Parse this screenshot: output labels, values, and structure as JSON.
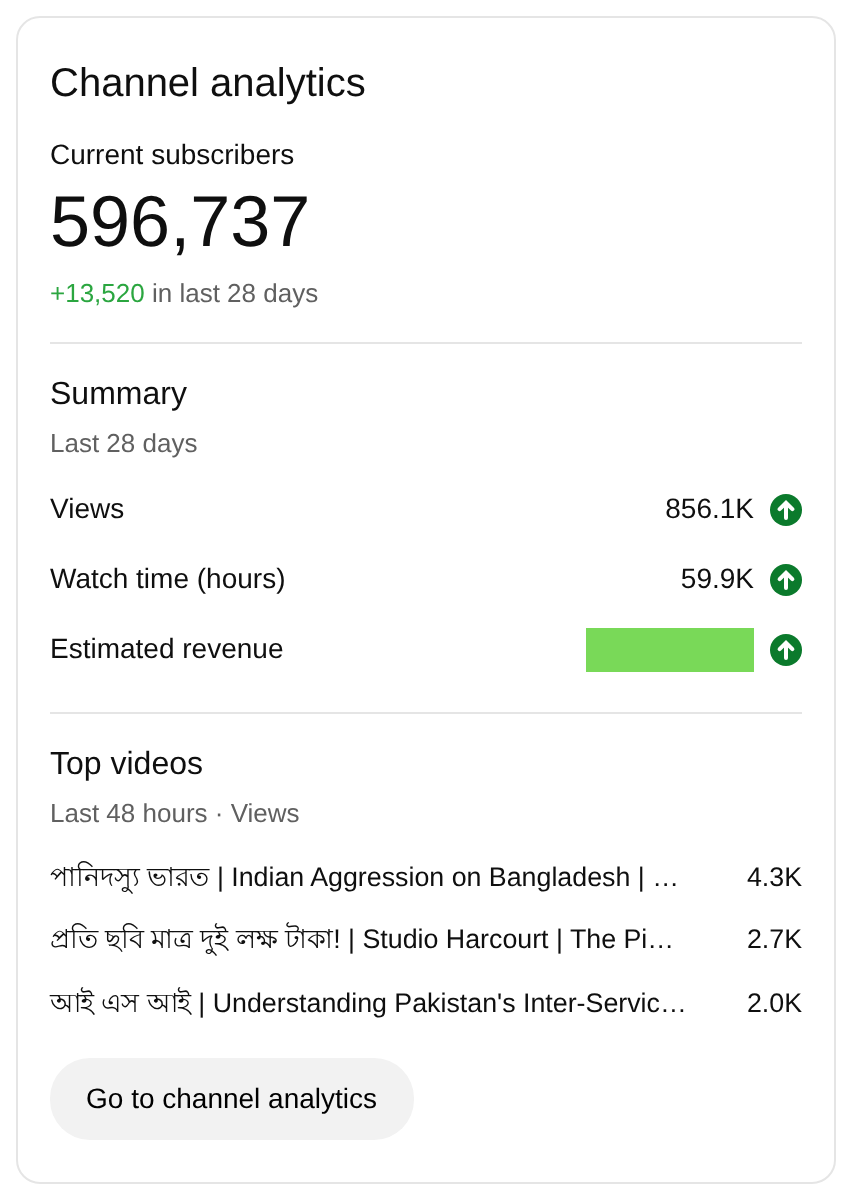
{
  "title": "Channel analytics",
  "subscribers": {
    "label": "Current subscribers",
    "count": "596,737",
    "change": "+13,520",
    "change_period": "in last 28 days"
  },
  "summary": {
    "title": "Summary",
    "period": "Last 28 days",
    "metrics": [
      {
        "kind": "value",
        "label": "Views",
        "value": "856.1K",
        "trending_up": true
      },
      {
        "kind": "value",
        "label": "Watch time (hours)",
        "value": "59.9K",
        "trending_up": true
      },
      {
        "kind": "redacted",
        "label": "Estimated revenue",
        "color": "#79d958",
        "trending_up": true
      }
    ]
  },
  "top_videos": {
    "title": "Top videos",
    "period": "Last 48 hours · Views",
    "videos": [
      {
        "title": "পানিদস্যু ভারত | Indian Aggression on Bangladesh | …",
        "views": "4.3K"
      },
      {
        "title": "প্রতি ছবি মাত্র দুই লক্ষ টাকা! | Studio Harcourt | The Pi…",
        "views": "2.7K"
      },
      {
        "title": "আই এস আই | Understanding Pakistan's Inter-Servic…",
        "views": "2.0K"
      }
    ]
  },
  "button": "Go to channel analytics"
}
